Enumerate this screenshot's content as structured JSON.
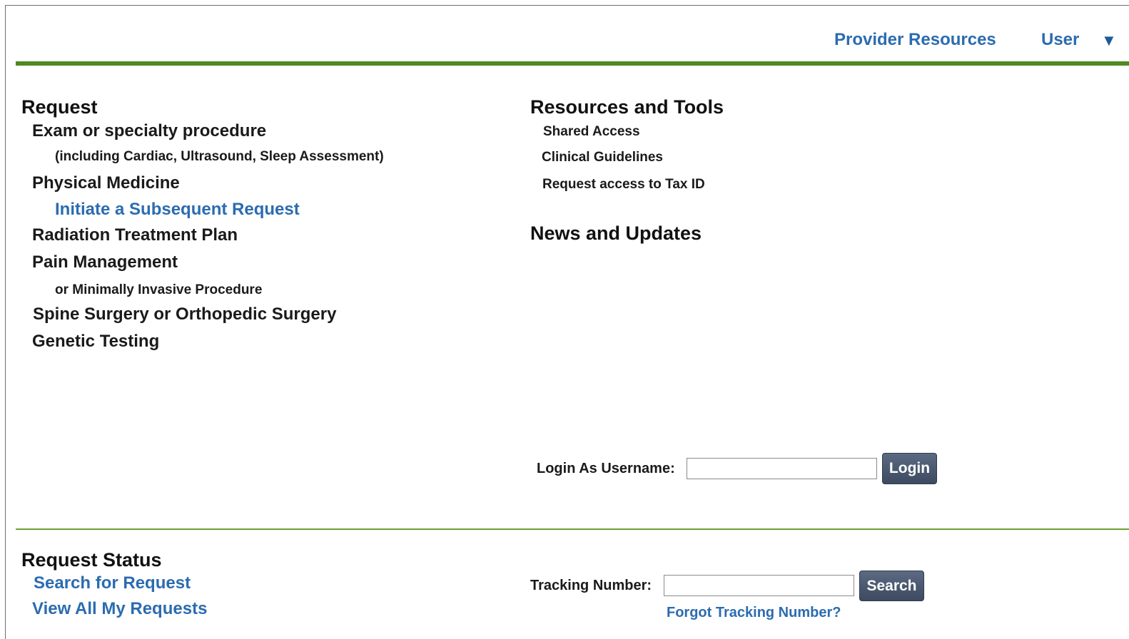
{
  "header": {
    "provider_resources": "Provider Resources",
    "user": "User",
    "user_menu_arrow": "▼"
  },
  "request": {
    "heading": "Request",
    "exam": "Exam or specialty procedure",
    "exam_sub": "(including Cardiac, Ultrasound, Sleep Assessment)",
    "physical_medicine": "Physical Medicine",
    "subsequent": "Initiate a Subsequent Request",
    "radiation": "Radiation Treatment Plan",
    "pain": "Pain Management",
    "pain_sub": "or Minimally Invasive Procedure",
    "spine": "Spine Surgery or Orthopedic Surgery",
    "genetic": "Genetic Testing"
  },
  "resources": {
    "heading": "Resources and Tools",
    "items": [
      "Shared Access",
      "Clinical Guidelines",
      "Request access to Tax ID"
    ]
  },
  "news": {
    "heading": "News and Updates"
  },
  "login": {
    "label": "Login As Username:",
    "value": "",
    "button": "Login"
  },
  "status": {
    "heading": "Request Status",
    "search_link": "Search for Request",
    "view_all": "View All My Requests",
    "tracking_label": "Tracking Number:",
    "tracking_value": "",
    "search_button": "Search",
    "forgot": "Forgot Tracking Number?"
  },
  "colors": {
    "accent_green": "#4e8a1e",
    "link_blue": "#2b6cb0",
    "button": "#46546b"
  }
}
